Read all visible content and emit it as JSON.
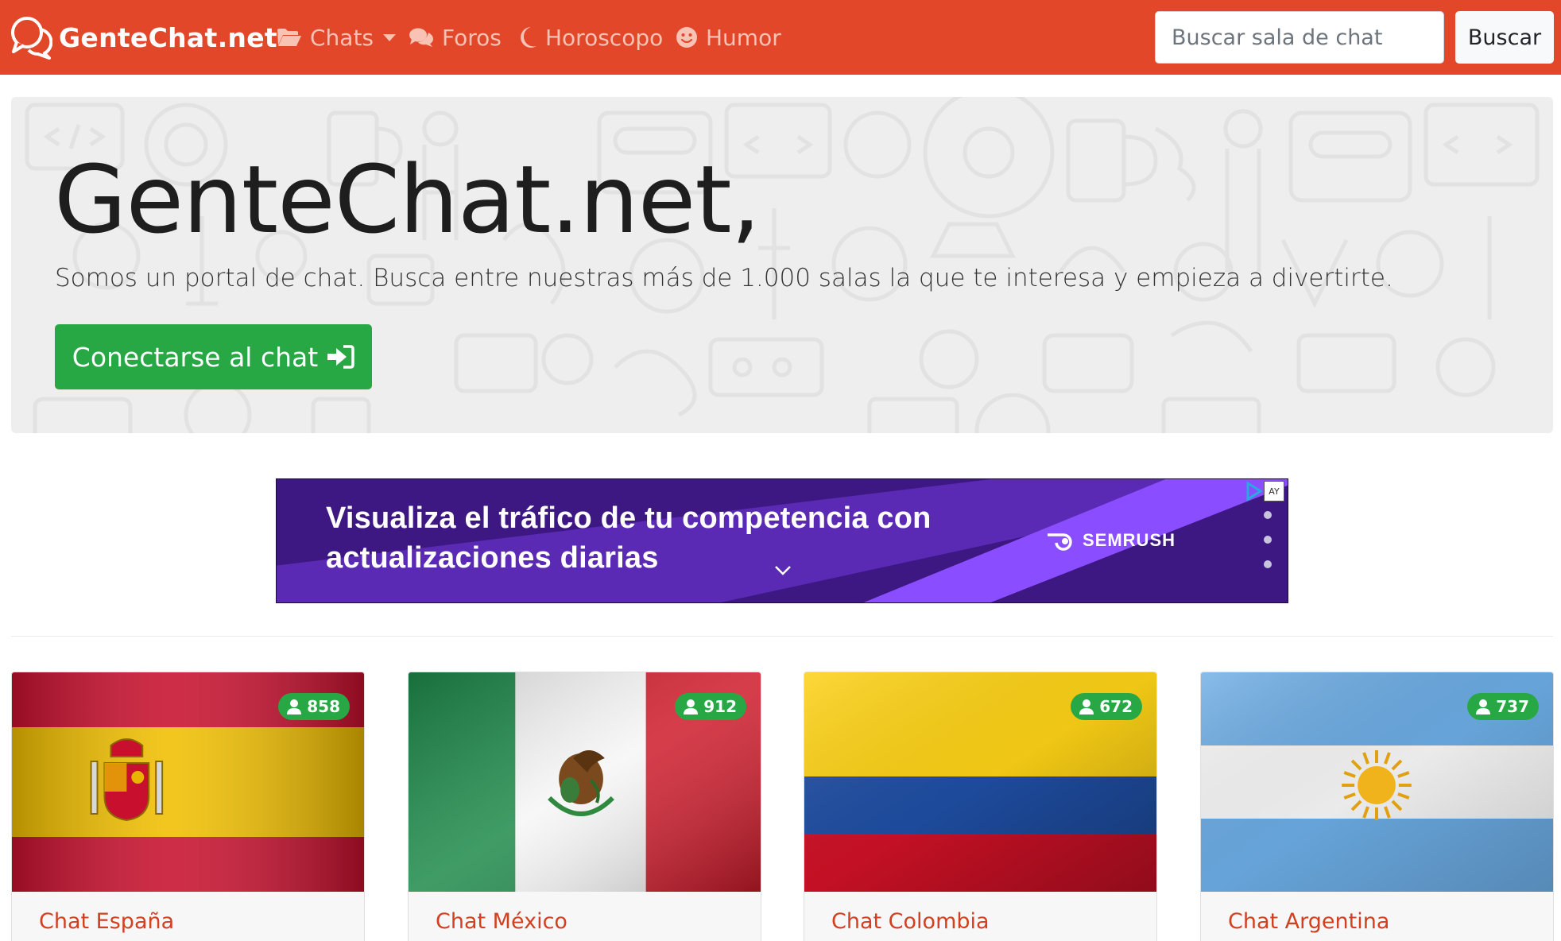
{
  "navbar": {
    "brand": "GenteChat.net",
    "items": [
      {
        "label": "Chats",
        "icon": "folder-open-icon",
        "dropdown": true
      },
      {
        "label": "Foros",
        "icon": "comments-icon"
      },
      {
        "label": "Horoscopo",
        "icon": "moon-icon"
      },
      {
        "label": "Humor",
        "icon": "smile-icon"
      }
    ],
    "search_placeholder": "Buscar sala de chat",
    "search_button": "Buscar",
    "color": "#e2472a"
  },
  "hero": {
    "title": "GenteChat.net,",
    "lead": "Somos un portal de chat. Busca entre nuestras más de 1.000 salas la que te interesa y empieza a divertirte.",
    "button": "Conectarse al chat",
    "button_icon": "sign-in-icon",
    "button_color": "#28a745"
  },
  "ad": {
    "line1": "Visualiza el tráfico de tu competencia con",
    "line2": "actualizaciones diarias",
    "brand": "SEMRUSH",
    "choices_label": "AY",
    "background": "#3d1883",
    "stripe": "#8a4dff"
  },
  "rooms": [
    {
      "title": "Chat España",
      "users": "858",
      "flag": "spain"
    },
    {
      "title": "Chat México",
      "users": "912",
      "flag": "mexico"
    },
    {
      "title": "Chat Colombia",
      "users": "672",
      "flag": "colombia"
    },
    {
      "title": "Chat Argentina",
      "users": "737",
      "flag": "argentina"
    }
  ]
}
